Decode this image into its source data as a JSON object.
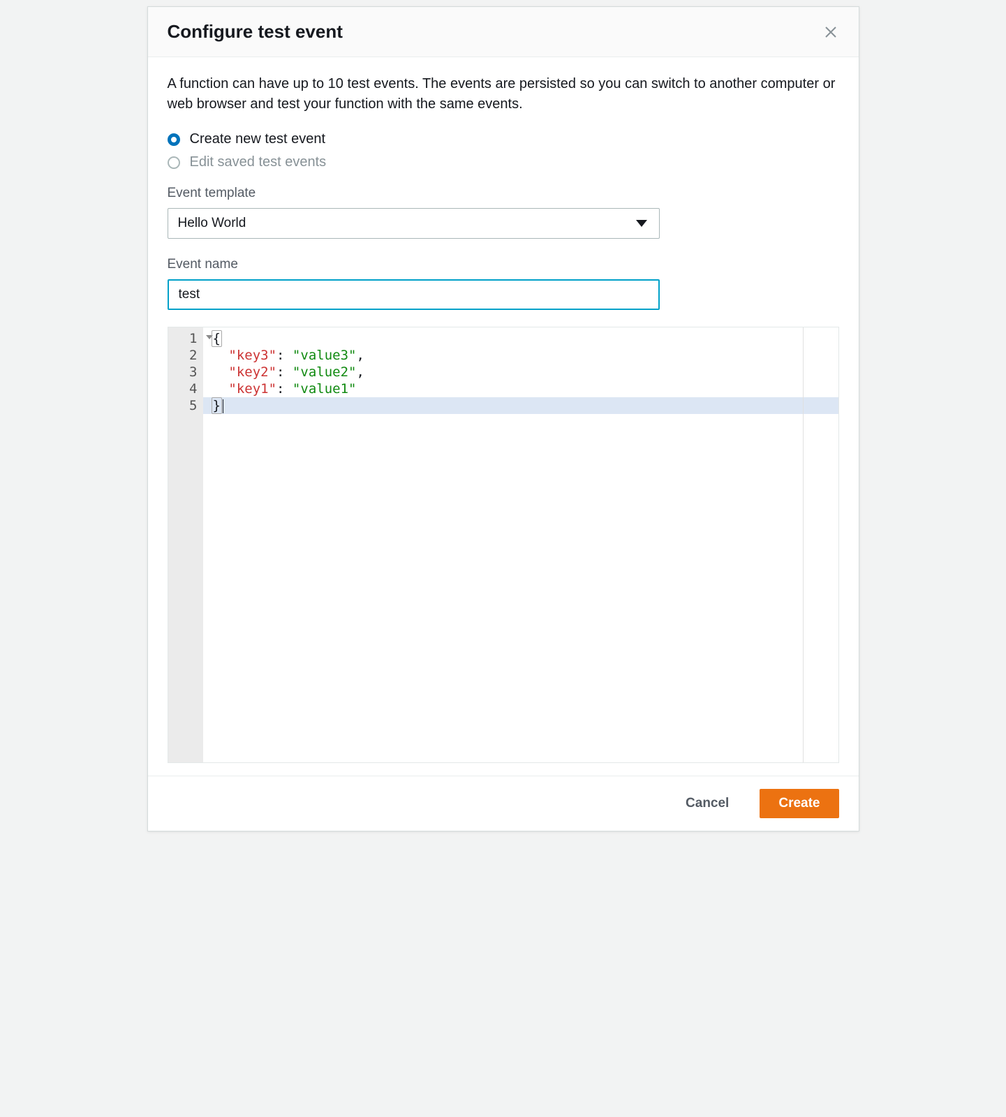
{
  "modal": {
    "title": "Configure test event",
    "description": "A function can have up to 10 test events. The events are persisted so you can switch to another computer or web browser and test your function with the same events.",
    "radio": {
      "create": "Create new test event",
      "edit": "Edit saved test events",
      "selected": "create",
      "editDisabled": true
    },
    "templateField": {
      "label": "Event template",
      "value": "Hello World"
    },
    "nameField": {
      "label": "Event name",
      "value": "test"
    },
    "editor": {
      "lines": [
        {
          "n": 1,
          "fold": true
        },
        {
          "n": 2
        },
        {
          "n": 3
        },
        {
          "n": 4
        },
        {
          "n": 5,
          "active": true
        }
      ],
      "json": {
        "key3": "value3",
        "key2": "value2",
        "key1": "value1"
      }
    },
    "footer": {
      "cancel": "Cancel",
      "create": "Create"
    }
  }
}
